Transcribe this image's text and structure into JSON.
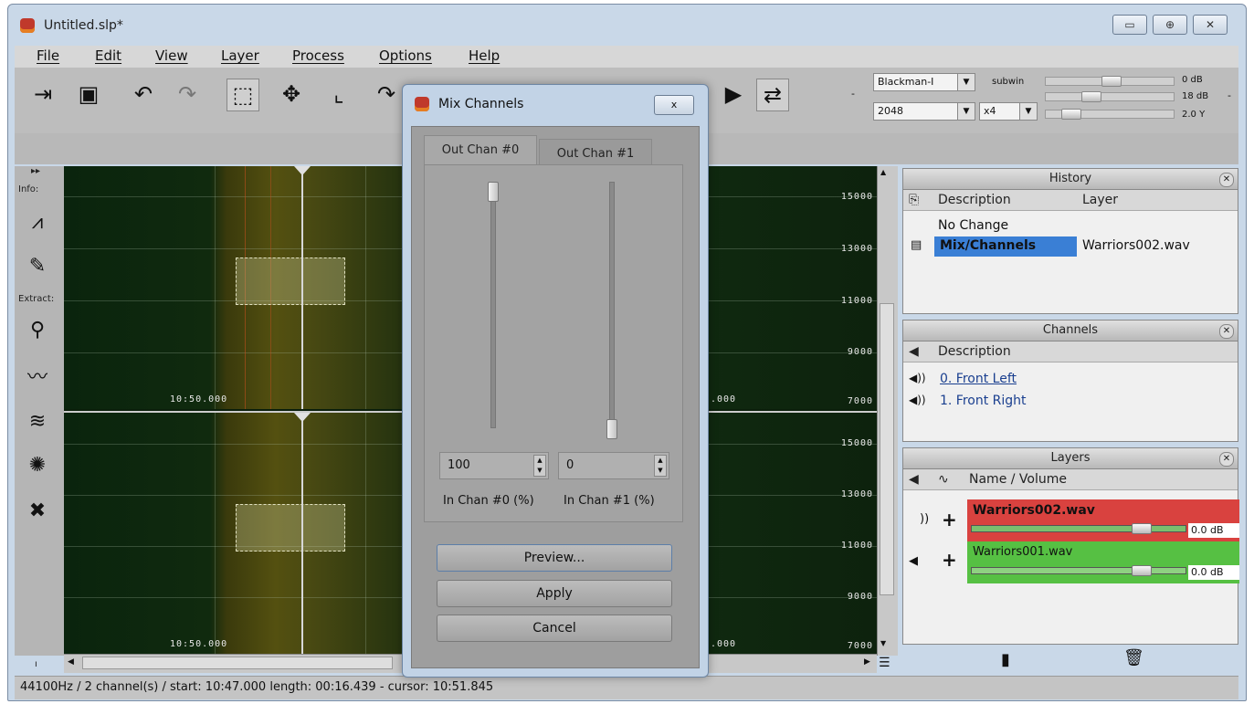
{
  "window": {
    "title": "Untitled.slp*"
  },
  "menu": [
    "File",
    "Edit",
    "View",
    "Layer",
    "Process",
    "Options",
    "Help"
  ],
  "toolbar": {
    "window_type": "Blackman-I",
    "fft_size": "2048",
    "subwin_label": "subwin",
    "overlap": "x4",
    "level_top": "0  dB",
    "level_mid": "18  dB",
    "level_bottom": "2.0 Y",
    "minus_left": "-",
    "minus_right": "-"
  },
  "leftstrip": {
    "info_label": "Info:",
    "extract_label": "Extract:",
    "collapse": "▸▸"
  },
  "spectrogram": {
    "freq_top": [
      "15000",
      "13000",
      "11000",
      "9000",
      "7000"
    ],
    "freq_bottom": [
      "15000",
      "13000",
      "11000",
      "9000",
      "7000"
    ],
    "time_label_top": "10:50.000",
    "time_label_top_right": ".000",
    "time_label_bottom": "10:50.000",
    "time_label_bottom_right": ".000"
  },
  "history": {
    "title": "History",
    "col_description": "Description",
    "col_layer": "Layer",
    "rows": [
      {
        "description": "No Change",
        "layer": ""
      },
      {
        "description": "Mix/Channels",
        "layer": "Warriors002.wav"
      }
    ]
  },
  "channels": {
    "title": "Channels",
    "col_description": "Description",
    "rows": [
      "0. Front Left",
      "1. Front Right"
    ]
  },
  "layers": {
    "title": "Layers",
    "col_name": "Name / Volume",
    "rows": [
      {
        "name": "Warriors002.wav",
        "volume": "0.0  dB",
        "color": "#d9423f"
      },
      {
        "name": "Warriors001.wav",
        "volume": "0.0  dB",
        "color": "#56c043"
      }
    ]
  },
  "status": {
    "text": "44100Hz / 2 channel(s) / start: 10:47.000 length:  00:16.439 - cursor:  10:51.845"
  },
  "dialog": {
    "title": "Mix Channels",
    "tabs": [
      "Out Chan #0",
      "Out Chan #1"
    ],
    "in0_value": "100",
    "in1_value": "0",
    "in0_label": "In Chan #0 (%)",
    "in1_label": "In Chan #1 (%)",
    "preview": "Preview...",
    "apply": "Apply",
    "cancel": "Cancel",
    "close": "x"
  },
  "colors": {
    "selection": "#3a7fd5",
    "layer_red": "#d9423f",
    "layer_green": "#56c043"
  }
}
